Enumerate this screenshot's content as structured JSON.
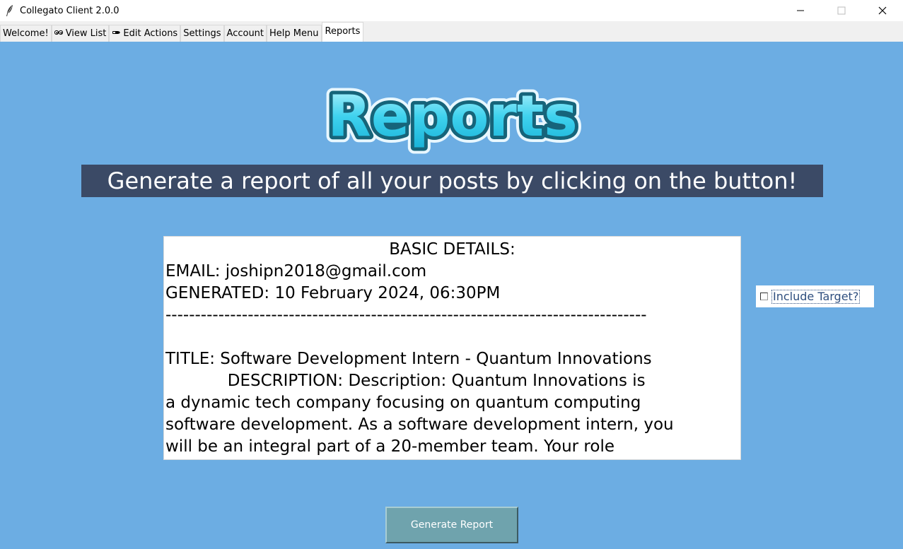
{
  "window": {
    "title": "Collegato Client 2.0.0",
    "controls": {
      "minimize": "—",
      "maximize": "☐",
      "close": "✕"
    }
  },
  "tabs": [
    {
      "label": "Welcome!",
      "icon": "",
      "active": false
    },
    {
      "label": "View List",
      "icon": "eyes-icon",
      "active": false
    },
    {
      "label": "Edit Actions",
      "icon": "pencil-icon",
      "active": false
    },
    {
      "label": "Settings",
      "icon": "",
      "active": false
    },
    {
      "label": "Account",
      "icon": "",
      "active": false
    },
    {
      "label": "Help Menu",
      "icon": "",
      "active": false
    },
    {
      "label": "Reports",
      "icon": "",
      "active": true
    }
  ],
  "logo": {
    "text": "Reports"
  },
  "headline": "Generate a report of all your posts by clicking on the button!",
  "report": {
    "heading": "BASIC DETAILS:",
    "email_line": "EMAIL: joshipn2018@gmail.com",
    "generated_line": "GENERATED: 10 February 2024, 06:30PM",
    "separator": "----------------------------------------------------------------------------------",
    "blank": "",
    "title_line": "TITLE: Software Development Intern - Quantum Innovations",
    "description_lines": [
      "            DESCRIPTION: Description: Quantum Innovations is",
      "a dynamic tech company focusing on quantum computing",
      "software development. As a software development intern, you",
      "will be an integral part of a 20-member team. Your role"
    ]
  },
  "include_target": {
    "label": "Include Target?",
    "checked": false
  },
  "generate_button": {
    "label": "Generate Report"
  },
  "colors": {
    "background": "#6cade3",
    "headline_bg": "#3b4a66",
    "button_bg": "#6fa3ad"
  }
}
